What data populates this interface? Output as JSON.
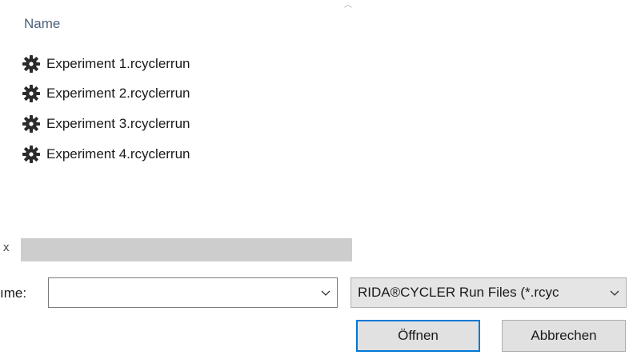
{
  "file_list": {
    "column_header": "Name",
    "sort_indicator": "^",
    "items": [
      {
        "name": "Experiment 1.rcyclerrun",
        "icon": "gear-icon"
      },
      {
        "name": "Experiment 2.rcyclerrun",
        "icon": "gear-icon"
      },
      {
        "name": "Experiment 3.rcyclerrun",
        "icon": "gear-icon"
      },
      {
        "name": "Experiment 4.rcyclerrun",
        "icon": "gear-icon"
      }
    ]
  },
  "scrollbar": {
    "label_fragment": "x"
  },
  "filename": {
    "label": "ıme:",
    "value": "",
    "placeholder": ""
  },
  "filetype": {
    "selected": "RIDA®CYCLER Run Files (*.rcyc"
  },
  "buttons": {
    "open": "Öffnen",
    "cancel": "Abbrechen"
  },
  "colors": {
    "header_text": "#4c607a",
    "focus_border": "#0078d7",
    "button_bg": "#e1e1e1",
    "scroll_thumb": "#cdcdcd"
  }
}
